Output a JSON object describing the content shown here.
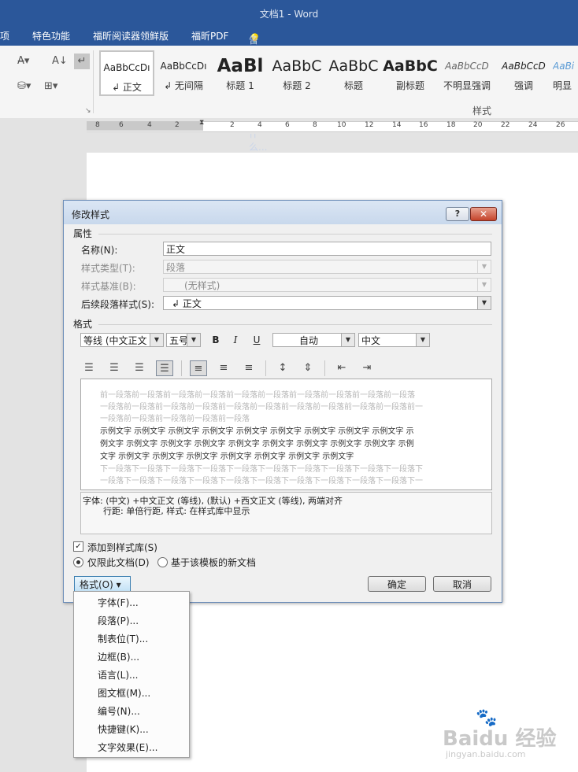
{
  "window": {
    "title": "文档1 - Word"
  },
  "tabs": [
    {
      "label": "项"
    },
    {
      "label": "特色功能"
    },
    {
      "label": "福昕阅读器领鲜版"
    },
    {
      "label": "福昕PDF"
    }
  ],
  "tell_me": {
    "text": "告诉我您想要做什么..."
  },
  "styles_gallery": {
    "group_label": "样式",
    "items": [
      {
        "preview": "AaBbCcDı",
        "name": "↲ 正文"
      },
      {
        "preview": "AaBbCcDı",
        "name": "↲ 无间隔"
      },
      {
        "preview": "AaBl",
        "name": "标题 1"
      },
      {
        "preview": "AaBbC",
        "name": "标题 2"
      },
      {
        "preview": "AaBbC",
        "name": "标题"
      },
      {
        "preview": "AaBbC",
        "name": "副标题"
      },
      {
        "preview": "AaBbCcD",
        "name": "不明显强调"
      },
      {
        "preview": "AaBbCcD",
        "name": "强调"
      },
      {
        "preview": "AaBi",
        "name": "明显"
      }
    ]
  },
  "ruler": {
    "numbers": [
      "8",
      "6",
      "4",
      "2",
      "2",
      "4",
      "6",
      "8",
      "10",
      "12",
      "14",
      "16",
      "18",
      "20",
      "22",
      "24",
      "26"
    ]
  },
  "dialog": {
    "title": "修改样式",
    "help_label": "?",
    "close_label": "✕",
    "properties_header": "属性",
    "name_label": "名称(N):",
    "name_value": "正文",
    "style_type_label": "样式类型(T):",
    "style_type_value": "段落",
    "based_on_label": "样式基准(B):",
    "based_on_value": "(无样式)",
    "following_label": "后续段落样式(S):",
    "following_value": "↲ 正文",
    "format_header": "格式",
    "font_value": "等线 (中文正文",
    "size_value": "五号",
    "bold_label": "B",
    "italic_label": "I",
    "underline_label": "U",
    "color_value": "自动",
    "script_value": "中文",
    "preview": {
      "prev_lines": [
        "前一段落前一段落前一段落前一段落前一段落前一段落前一段落前一段落前一段落前一段落",
        "一段落前一段落前一段落前一段落前一段落前一段落前一段落前一段落前一段落前一段落前一",
        "一段落前一段落前一段落前一段落前一段落"
      ],
      "sample_lines": [
        "示例文字 示例文字 示例文字 示例文字 示例文字 示例文字 示例文字 示例文字 示例文字 示",
        "例文字 示例文字 示例文字 示例文字 示例文字 示例文字 示例文字 示例文字 示例文字 示例",
        "文字 示例文字 示例文字 示例文字 示例文字 示例文字 示例文字 示例文字"
      ],
      "next_lines": [
        "下一段落下一段落下一段落下一段落下一段落下一段落下一段落下一段落下一段落下一段落下",
        "一段落下一段落下一段落下一段落下一段落下一段落下一段落下一段落下一段落下一段落下一"
      ]
    },
    "description_line1": "字体: (中文) +中文正文 (等线), (默认) +西文正文 (等线), 两端对齐",
    "description_line2": "行距: 单倍行距, 样式: 在样式库中显示",
    "add_to_gallery_label": "添加到样式库(S)",
    "only_doc_label": "仅限此文档(D)",
    "new_docs_label": "基于该模板的新文档",
    "format_button_label": "格式(O) ▾",
    "ok_label": "确定",
    "cancel_label": "取消"
  },
  "format_menu": {
    "items": [
      {
        "label": "字体(F)..."
      },
      {
        "label": "段落(P)..."
      },
      {
        "label": "制表位(T)..."
      },
      {
        "label": "边框(B)..."
      },
      {
        "label": "语言(L)..."
      },
      {
        "label": "图文框(M)..."
      },
      {
        "label": "编号(N)..."
      },
      {
        "label": "快捷键(K)..."
      },
      {
        "label": "文字效果(E)..."
      }
    ]
  },
  "watermark": {
    "brand": "Baidu 经验",
    "url": "jingyan.baidu.com"
  }
}
